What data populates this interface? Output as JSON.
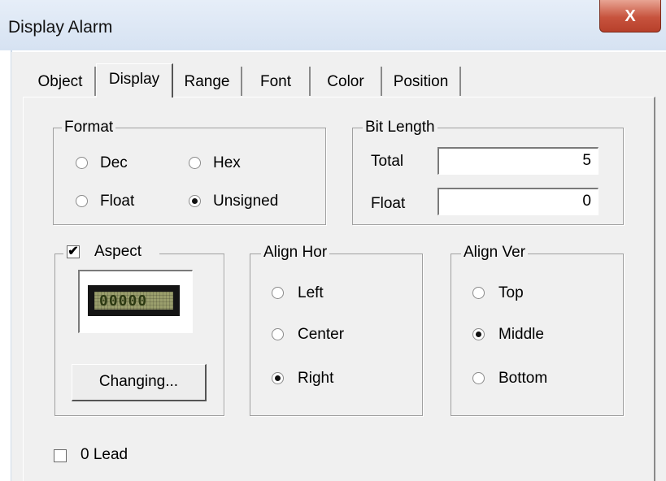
{
  "window": {
    "title": "Display Alarm",
    "close_glyph": "X"
  },
  "tabs": [
    {
      "label": "Object"
    },
    {
      "label": "Display"
    },
    {
      "label": "Range"
    },
    {
      "label": "Font"
    },
    {
      "label": "Color"
    },
    {
      "label": "Position"
    }
  ],
  "active_tab": "Display",
  "format": {
    "legend": "Format",
    "options": [
      {
        "label": "Dec",
        "selected": false
      },
      {
        "label": "Hex",
        "selected": false
      },
      {
        "label": "Float",
        "selected": false
      },
      {
        "label": "Unsigned",
        "selected": true
      }
    ]
  },
  "bit_length": {
    "legend": "Bit Length",
    "total_label": "Total",
    "total_value": "5",
    "float_label": "Float",
    "float_value": "0"
  },
  "aspect": {
    "label": "Aspect",
    "checked": true,
    "preview_digits": "00000",
    "button_label": "Changing..."
  },
  "align_hor": {
    "legend": "Align Hor",
    "options": [
      {
        "label": "Left",
        "selected": false
      },
      {
        "label": "Center",
        "selected": false
      },
      {
        "label": "Right",
        "selected": true
      }
    ]
  },
  "align_ver": {
    "legend": "Align Ver",
    "options": [
      {
        "label": "Top",
        "selected": false
      },
      {
        "label": "Middle",
        "selected": true
      },
      {
        "label": "Bottom",
        "selected": false
      }
    ]
  },
  "zero_lead": {
    "label": "0 Lead",
    "checked": false
  },
  "colors": {
    "title_bar": "#dce6f4",
    "close_button": "#c7533d",
    "dialog_bg": "#f0f0f0"
  }
}
